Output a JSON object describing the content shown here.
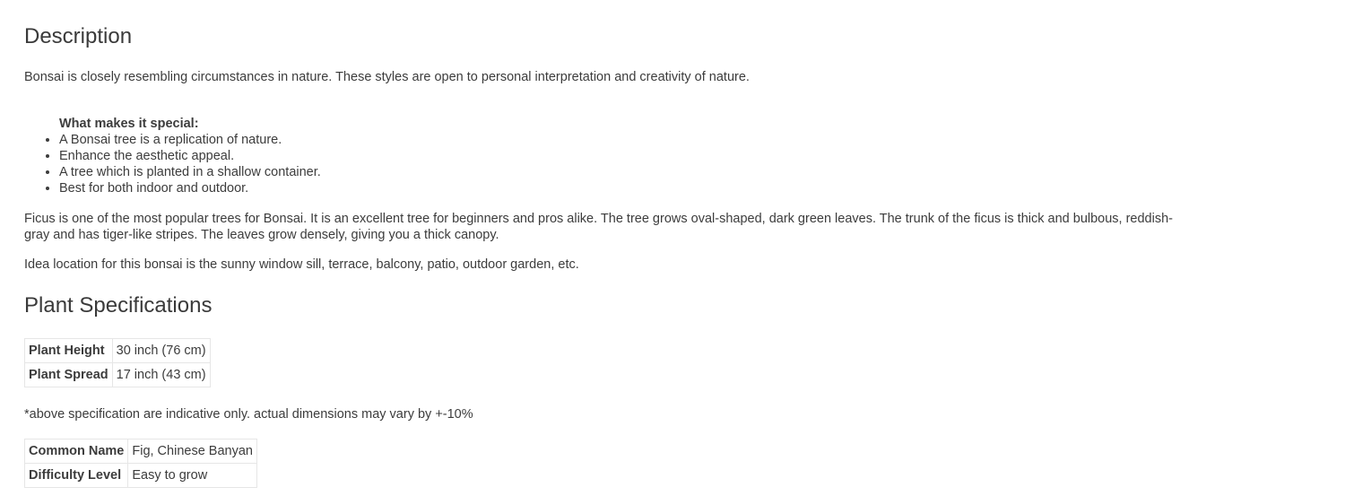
{
  "description": {
    "heading": "Description",
    "intro": "Bonsai is closely resembling circumstances in nature. These styles are open to personal interpretation and creativity of nature.",
    "special_title": "What makes it special:",
    "special_items": [
      "A Bonsai tree is a replication of nature.",
      "Enhance the aesthetic appeal.",
      "A tree which is planted in a shallow container.",
      "Best for both indoor and outdoor."
    ],
    "ficus": "Ficus is one of the most popular trees for Bonsai. It is an excellent tree for beginners and pros alike. The tree grows oval-shaped, dark green leaves. The trunk of the ficus is thick and bulbous, reddish-gray and has tiger-like stripes. The leaves grow densely, giving you a thick canopy.",
    "location": "Idea location for this bonsai is the sunny window sill, terrace, balcony, patio, outdoor garden, etc."
  },
  "specs": {
    "heading": "Plant Specifications",
    "size_table": [
      {
        "key": "Plant Height",
        "value": "30 inch (76 cm)"
      },
      {
        "key": "Plant Spread",
        "value": "17 inch (43 cm)"
      }
    ],
    "note": "*above specification are indicative only. actual dimensions may vary by +-10%",
    "info_table": [
      {
        "key": "Common Name",
        "value": "Fig, Chinese Banyan"
      },
      {
        "key": "Difficulty Level",
        "value": "Easy to grow"
      }
    ]
  }
}
